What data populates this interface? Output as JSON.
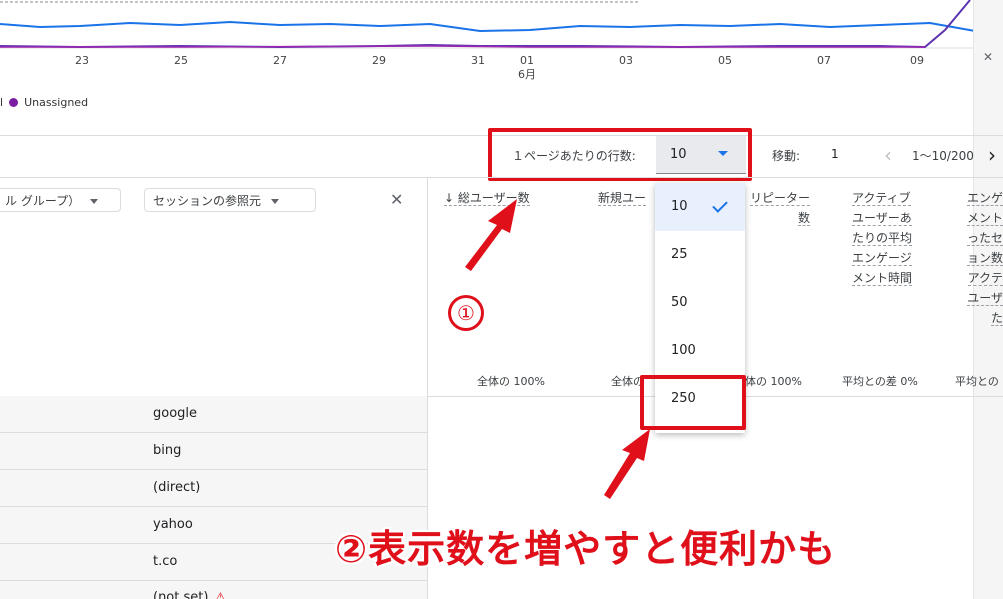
{
  "chart": {
    "x_ticks": [
      "23",
      "25",
      "27",
      "29",
      "31",
      "01",
      "03",
      "05",
      "07",
      "09"
    ],
    "month_label": "6月",
    "legend": [
      {
        "label": "l",
        "color": ""
      },
      {
        "label": "Unassigned",
        "color": "#7b1fa2"
      }
    ]
  },
  "pagination": {
    "rows_per_page_label": "１ページあたりの行数:",
    "rows_per_page_value": "10",
    "move_label": "移動:",
    "move_value": "1",
    "range": "1〜10/200"
  },
  "filters": {
    "chip1": "ル グループ）",
    "chip2": "セッションの参照元"
  },
  "columns": [
    {
      "lines": [
        "↓ 総ユーザー数"
      ],
      "total": "全体の 100%"
    },
    {
      "lines": [
        "新規ユー"
      ],
      "total": "全体の"
    },
    {
      "lines": [
        "リピーター",
        "数"
      ],
      "total": "体の 100%"
    },
    {
      "lines": [
        "アクティブ",
        "ユーザーあ",
        "たりの平均",
        "エンゲージ",
        "メント時間"
      ],
      "total": "平均との差 0%"
    },
    {
      "lines": [
        "エンゲ",
        "メント",
        "ったセ",
        "ョン数",
        "アクテ",
        "ユーザ",
        "た"
      ],
      "total": "平均との"
    }
  ],
  "rows": [
    "google",
    "bing",
    "(direct)",
    "yahoo",
    "t.co",
    "(not set)"
  ],
  "dropdown": {
    "options": [
      "10",
      "25",
      "50",
      "100",
      "250"
    ],
    "selected": "10"
  },
  "annotations": {
    "step1": "①",
    "step2": "②表示数を増やすと便利かも"
  },
  "colors": {
    "accent": "#1a73e8",
    "annotation_red": "#e0101b",
    "series_purple": "#7b1fa2"
  }
}
